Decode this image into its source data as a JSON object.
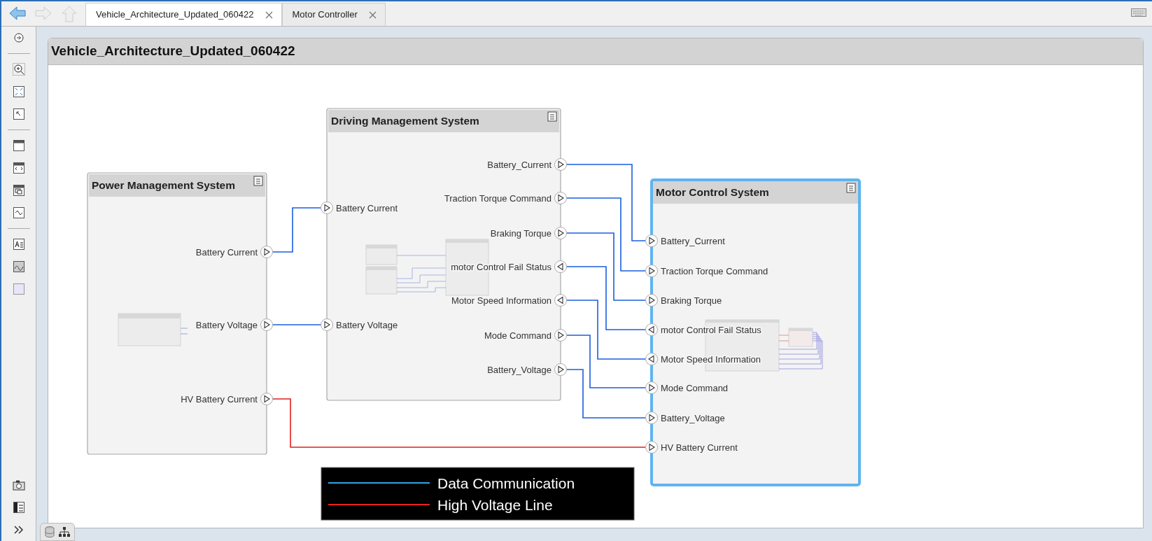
{
  "tabs": [
    {
      "label": "Vehicle_Architecture_Updated_060422",
      "selected": true
    },
    {
      "label": "Motor Controller",
      "selected": false
    }
  ],
  "diagram": {
    "title": "Vehicle_Architecture_Updated_060422",
    "blocks": [
      {
        "title": "Power Management System",
        "selected": false,
        "ports": [
          {
            "label": "Battery Current",
            "kind": "output"
          },
          {
            "label": "Battery Voltage",
            "kind": "output"
          },
          {
            "label": "HV Battery Current",
            "kind": "output"
          }
        ]
      },
      {
        "title": "Driving Management System",
        "selected": false,
        "ports": [
          {
            "label": "Battery Current",
            "kind": "input"
          },
          {
            "label": "Battery Voltage",
            "kind": "input"
          },
          {
            "label": "Battery_Current",
            "kind": "output"
          },
          {
            "label": "Traction Torque Command",
            "kind": "output"
          },
          {
            "label": "Braking Torque",
            "kind": "output"
          },
          {
            "label": "motor Control Fail Status",
            "kind": "input"
          },
          {
            "label": "Motor Speed Information",
            "kind": "input"
          },
          {
            "label": "Mode Command",
            "kind": "output"
          },
          {
            "label": "Battery_Voltage",
            "kind": "output"
          }
        ]
      },
      {
        "title": "Motor Control System",
        "selected": true,
        "ports": [
          {
            "label": "Battery_Current",
            "kind": "input"
          },
          {
            "label": "Traction Torque Command",
            "kind": "input"
          },
          {
            "label": "Braking Torque",
            "kind": "input"
          },
          {
            "label": "motor Control Fail Status",
            "kind": "output"
          },
          {
            "label": "Motor Speed Information",
            "kind": "output"
          },
          {
            "label": "Mode Command",
            "kind": "input"
          },
          {
            "label": "Battery_Voltage",
            "kind": "input"
          },
          {
            "label": "HV Battery Current",
            "kind": "input"
          }
        ]
      }
    ],
    "connections": [
      {
        "kind": "data"
      },
      {
        "kind": "data"
      },
      {
        "kind": "high_voltage"
      },
      {
        "kind": "data"
      },
      {
        "kind": "data"
      },
      {
        "kind": "data"
      },
      {
        "kind": "data"
      },
      {
        "kind": "data"
      },
      {
        "kind": "data"
      },
      {
        "kind": "data"
      }
    ],
    "legend": [
      {
        "label": "Data Communication",
        "kind": "data"
      },
      {
        "label": "High Voltage Line",
        "kind": "high_voltage"
      }
    ]
  }
}
